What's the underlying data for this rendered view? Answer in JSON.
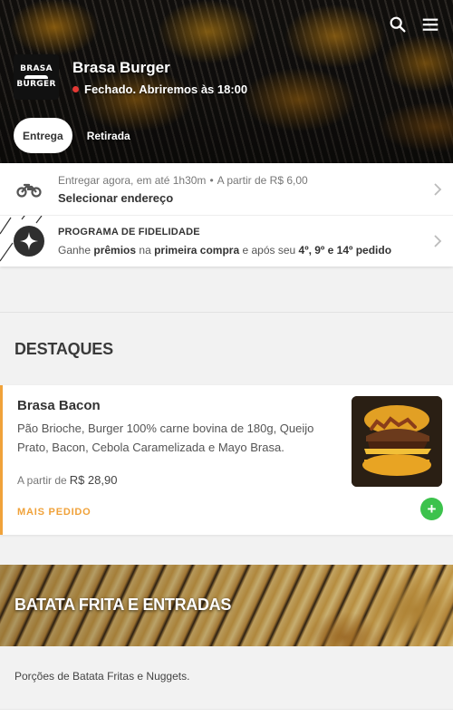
{
  "header": {
    "store_name": "Brasa Burger",
    "status_text": "Fechado. Abriremos às 18:00",
    "status_color": "#e53935",
    "logo_text_top": "BRASA",
    "logo_text_bottom": "BURGER",
    "icons": [
      "search-icon",
      "menu-icon"
    ],
    "tabs": [
      {
        "label": "Entrega",
        "active": true
      },
      {
        "label": "Retirada",
        "active": false
      }
    ]
  },
  "delivery": {
    "icon": "motorcycle-icon",
    "time_text": "Entregar agora, em até 1h30m",
    "separator": "•",
    "min_text": "A partir de R$ 6,00",
    "address_label": "Selecionar endereço"
  },
  "loyalty": {
    "icon": "sparkle-badge-icon",
    "title": "PROGRAMA DE FIDELIDADE",
    "desc_1": "Ganhe ",
    "desc_bold_1": "prêmios",
    "desc_2": " na ",
    "desc_bold_2": "primeira compra",
    "desc_3": " e após seu ",
    "desc_bold_3": "4º, 9º e 14º pedido"
  },
  "highlights": {
    "title": "DESTAQUES",
    "product": {
      "name": "Brasa Bacon",
      "description": "Pão Brioche, Burger 100% carne bovina de 180g, Queijo Prato, Bacon, Cebola Caramelizada e Mayo Brasa.",
      "price_prefix": "A partir de",
      "price": "R$ 28,90",
      "tag": "MAIS PEDIDO",
      "add_symbol": "+"
    }
  },
  "category": {
    "title": "BATATA FRITA E ENTRADAS",
    "description": "Porções de Batata Fritas e Nuggets."
  },
  "colors": {
    "accent": "#f0a23a",
    "add_button": "#3cc24c"
  }
}
